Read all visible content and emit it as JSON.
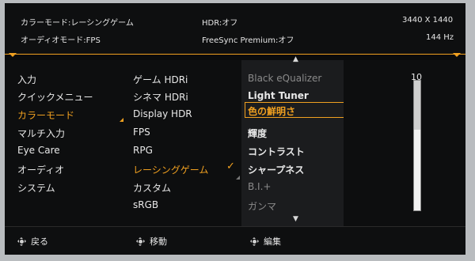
{
  "info": {
    "picture_mode": "カラーモード:レーシングゲーム",
    "hdr": "HDR:オフ",
    "resolution": "3440 X 1440",
    "audio_mode": "オーディオモード:FPS",
    "freesync": "FreeSync Premium:オフ",
    "refresh": "144 Hz"
  },
  "menu": {
    "items": [
      "入力",
      "クイックメニュー",
      "カラーモード",
      "マルチ入力",
      "Eye Care",
      "オーディオ",
      "システム"
    ]
  },
  "submenu": {
    "items": [
      "ゲーム HDRi",
      "シネマ HDRi",
      "Display HDR",
      "FPS",
      "RPG",
      "レーシングゲーム",
      "カスタム",
      "sRGB"
    ]
  },
  "options": {
    "items": [
      "Black eQualizer",
      "Light Tuner",
      "色の鮮明さ",
      "輝度",
      "コントラスト",
      "シャープネス",
      "B.I.+",
      "ガンマ"
    ]
  },
  "slider": {
    "value": "10",
    "level_fraction": 0.62
  },
  "footer": {
    "back": "戻る",
    "move": "移動",
    "enter": "編集"
  },
  "colors": {
    "accent": "#f0a020",
    "panel": "#1b1c1e",
    "background": "#0a0b0c"
  },
  "icons": {
    "scroll_up": "▲",
    "scroll_down": "▼",
    "check": "✓"
  }
}
